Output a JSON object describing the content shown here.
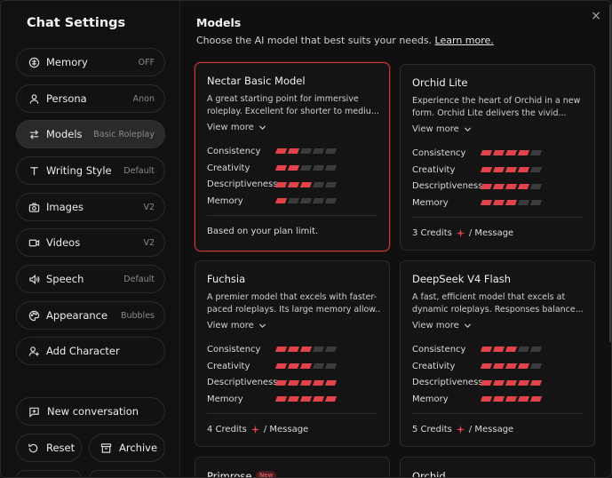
{
  "sidebar": {
    "title": "Chat Settings",
    "items": [
      {
        "label": "Memory",
        "value": "OFF",
        "icon": "memory-icon"
      },
      {
        "label": "Persona",
        "value": "Anon",
        "icon": "persona-icon"
      },
      {
        "label": "Models",
        "value": "Basic Roleplay",
        "icon": "swap-arrows-icon",
        "active": true
      },
      {
        "label": "Writing Style",
        "value": "Default",
        "icon": "text-t-icon"
      },
      {
        "label": "Images",
        "value": "V2",
        "icon": "camera-icon"
      },
      {
        "label": "Videos",
        "value": "V2",
        "icon": "video-icon"
      },
      {
        "label": "Speech",
        "value": "Default",
        "icon": "speaker-icon"
      },
      {
        "label": "Appearance",
        "value": "Bubbles",
        "icon": "palette-icon"
      },
      {
        "label": "Add Character",
        "value": "",
        "icon": "add-user-icon"
      }
    ],
    "bottom": {
      "new_conversation": "New conversation",
      "reset": "Reset",
      "archive": "Archive"
    }
  },
  "main": {
    "title": "Models",
    "subtitle": "Choose the AI model that best suits your needs.",
    "learn_more": "Learn more.",
    "close_label": "×",
    "stat_labels": [
      "Consistency",
      "Creativity",
      "Descriptiveness",
      "Memory"
    ],
    "view_more": "View more",
    "cards": [
      {
        "name": "Nectar Basic Model",
        "desc1": "A great starting point for immersive",
        "desc2": "roleplay. Excellent for shorter to mediu...",
        "ratings": [
          2,
          2,
          3,
          1
        ],
        "footer": "Based on your plan limit.",
        "selected": true
      },
      {
        "name": "Orchid Lite",
        "desc1": "Experience the heart of Orchid in a new",
        "desc2": "form. Orchid Lite delivers the vivid...",
        "ratings": [
          4,
          4,
          4,
          3
        ],
        "credits": "3 Credits",
        "per": "/ Message"
      },
      {
        "name": "Fuchsia",
        "desc1": "A premier model that excels with faster-",
        "desc2": "paced roleplays. Its large memory allow...",
        "ratings": [
          3,
          3,
          5,
          5
        ],
        "credits": "4 Credits",
        "per": "/ Message"
      },
      {
        "name": "DeepSeek V4 Flash",
        "desc1": "A fast, efficient model that excels at",
        "desc2": "dynamic roleplays. Responses balance...",
        "ratings": [
          3,
          4,
          5,
          5
        ],
        "credits": "5 Credits",
        "per": "/ Message"
      }
    ],
    "partial": [
      {
        "name": "Primrose",
        "badge": "New"
      },
      {
        "name": "Orchid"
      }
    ]
  },
  "colors": {
    "accent": "#e2434a",
    "selected_border": "#c9383d"
  }
}
